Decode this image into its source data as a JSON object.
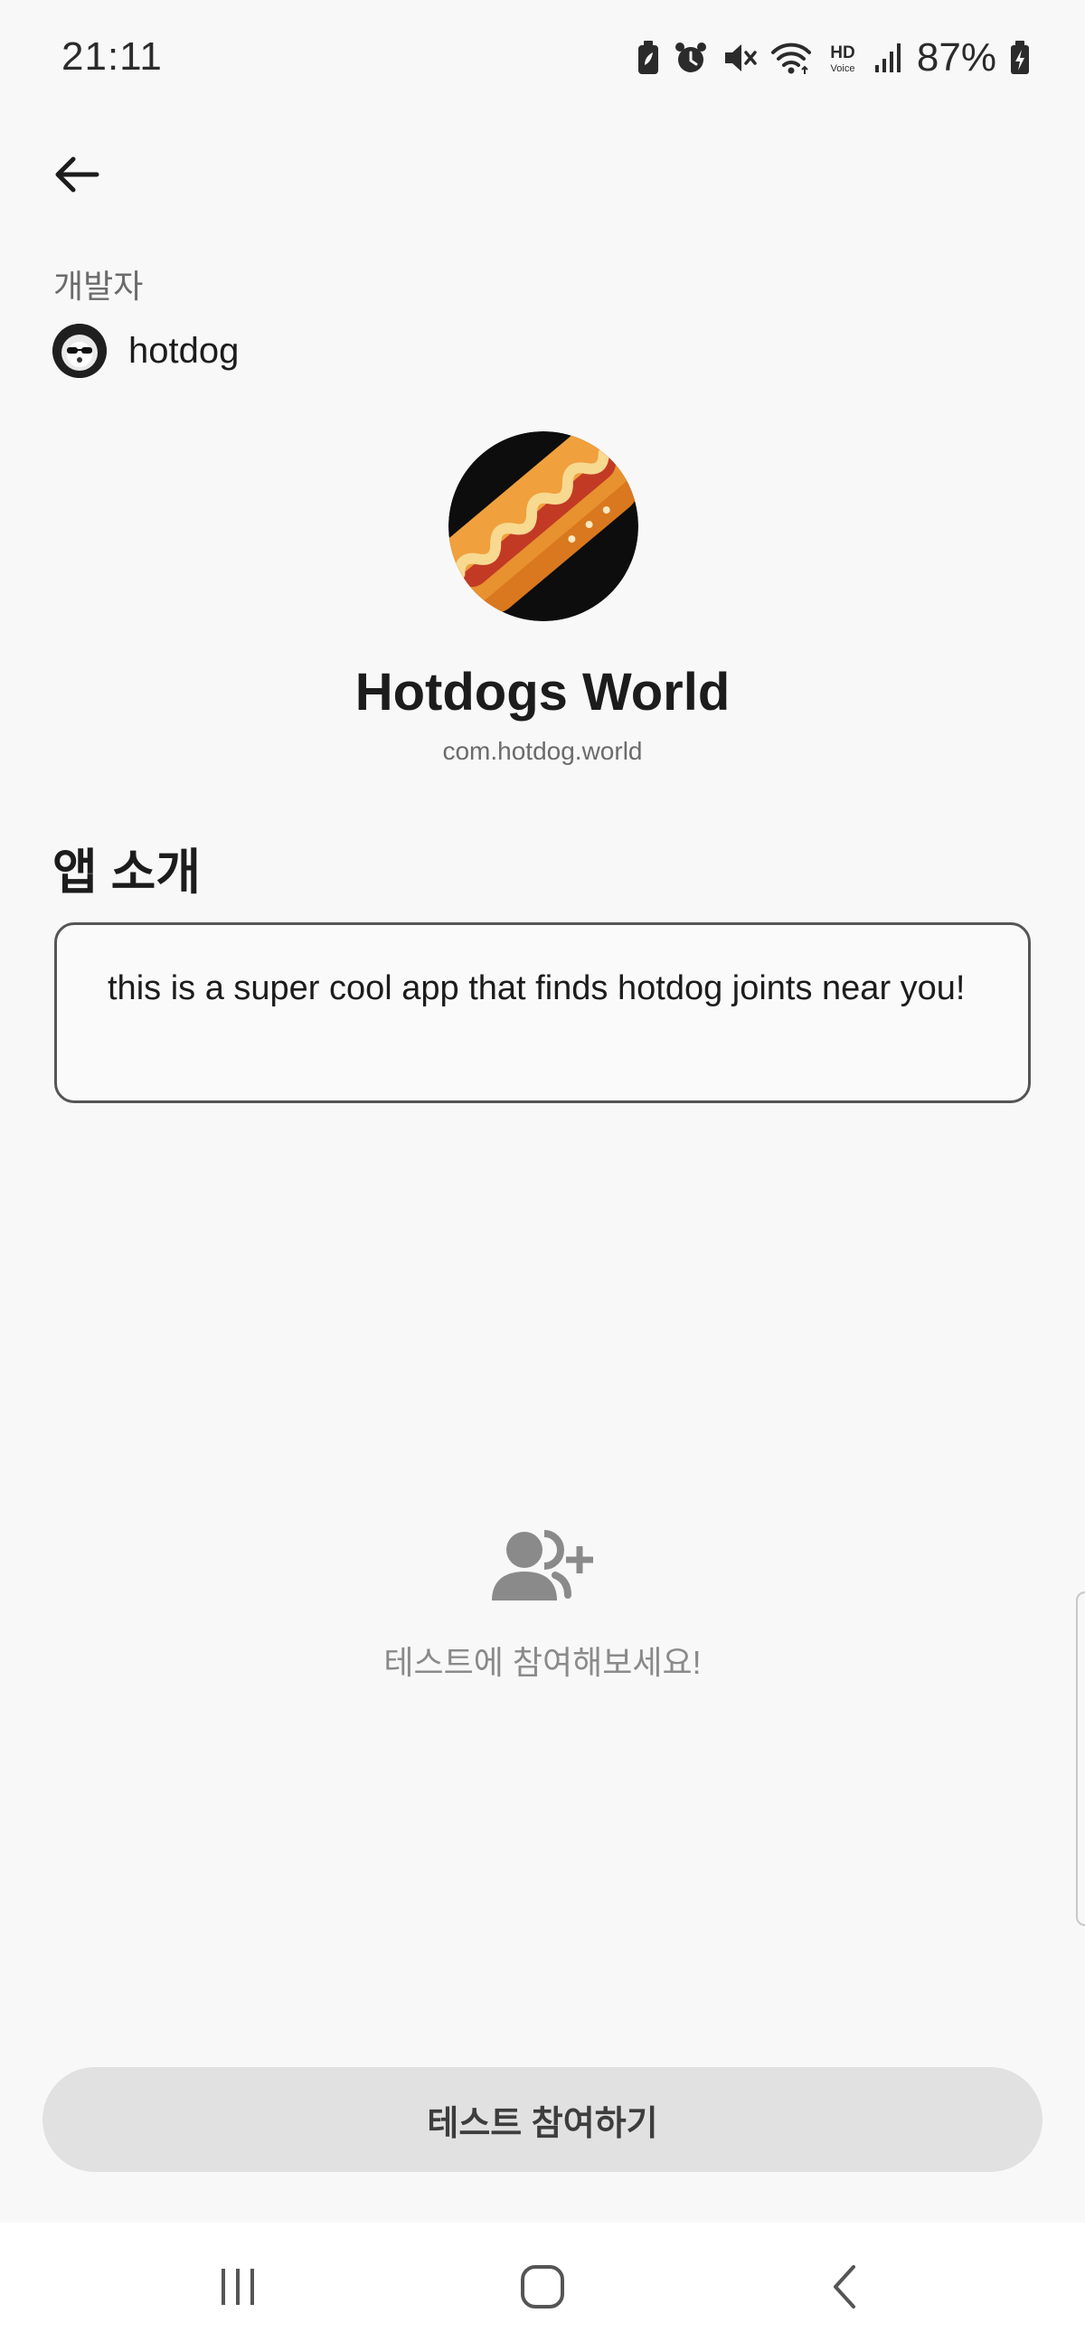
{
  "status_bar": {
    "time": "21:11",
    "battery_percent": "87%",
    "icons": [
      "battery-saver-icon",
      "alarm-icon",
      "mute-icon",
      "wifi-icon",
      "hd-voice-icon",
      "signal-icon",
      "battery-charging-icon"
    ],
    "hd_top": "HD",
    "hd_bottom": "Voice"
  },
  "header": {
    "back_icon": "arrow-left-icon"
  },
  "developer": {
    "label": "개발자",
    "name": "hotdog"
  },
  "app": {
    "title": "Hotdogs World",
    "package": "com.hotdog.world",
    "icon": "hotdog-app-icon"
  },
  "intro": {
    "heading": "앱 소개",
    "description": "this is a super cool app that finds hotdog joints near you!"
  },
  "testers": {
    "icon": "add-user-icon",
    "empty_message": "테스트에 참여해보세요!"
  },
  "join_button": {
    "label": "테스트 참여하기"
  },
  "colors": {
    "background": "#f8f8f8",
    "button_bg": "#e1e1e1",
    "muted_text": "#8a8a8a",
    "hotdog_orange": "#e8912f"
  },
  "nav_bar": {
    "icons": [
      "recent-apps-icon",
      "home-icon",
      "back-icon"
    ]
  }
}
